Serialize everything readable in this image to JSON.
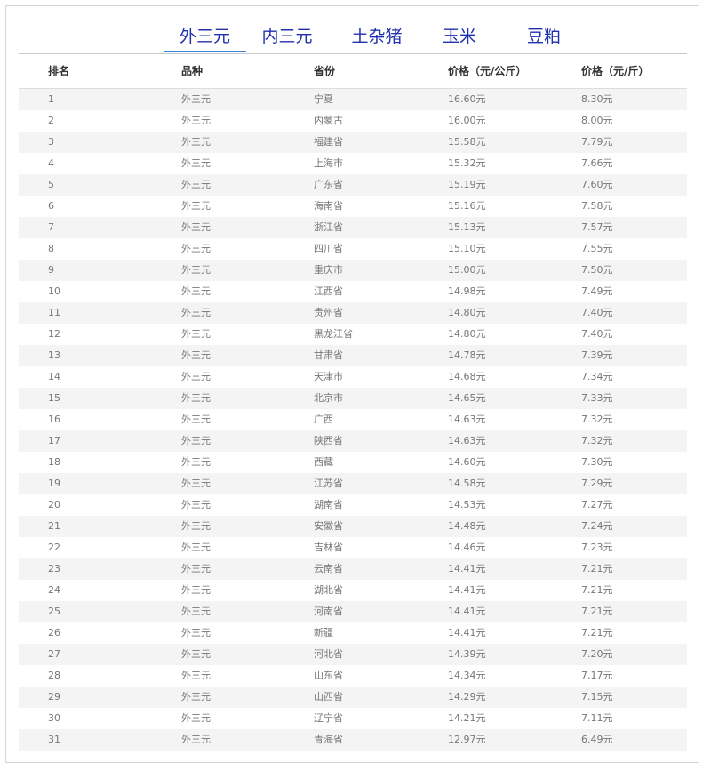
{
  "tabs": [
    {
      "label": "外三元",
      "active": true
    },
    {
      "label": "内三元",
      "active": false
    },
    {
      "label": "土杂猪",
      "active": false
    },
    {
      "label": "玉米",
      "active": false
    },
    {
      "label": "豆粕",
      "active": false
    }
  ],
  "table": {
    "headers": [
      "排名",
      "品种",
      "省份",
      "价格（元/公斤）",
      "价格（元/斤）"
    ],
    "rows": [
      [
        "1",
        "外三元",
        "宁夏",
        "16.60元",
        "8.30元"
      ],
      [
        "2",
        "外三元",
        "内蒙古",
        "16.00元",
        "8.00元"
      ],
      [
        "3",
        "外三元",
        "福建省",
        "15.58元",
        "7.79元"
      ],
      [
        "4",
        "外三元",
        "上海市",
        "15.32元",
        "7.66元"
      ],
      [
        "5",
        "外三元",
        "广东省",
        "15.19元",
        "7.60元"
      ],
      [
        "6",
        "外三元",
        "海南省",
        "15.16元",
        "7.58元"
      ],
      [
        "7",
        "外三元",
        "浙江省",
        "15.13元",
        "7.57元"
      ],
      [
        "8",
        "外三元",
        "四川省",
        "15.10元",
        "7.55元"
      ],
      [
        "9",
        "外三元",
        "重庆市",
        "15.00元",
        "7.50元"
      ],
      [
        "10",
        "外三元",
        "江西省",
        "14.98元",
        "7.49元"
      ],
      [
        "11",
        "外三元",
        "贵州省",
        "14.80元",
        "7.40元"
      ],
      [
        "12",
        "外三元",
        "黑龙江省",
        "14.80元",
        "7.40元"
      ],
      [
        "13",
        "外三元",
        "甘肃省",
        "14.78元",
        "7.39元"
      ],
      [
        "14",
        "外三元",
        "天津市",
        "14.68元",
        "7.34元"
      ],
      [
        "15",
        "外三元",
        "北京市",
        "14.65元",
        "7.33元"
      ],
      [
        "16",
        "外三元",
        "广西",
        "14.63元",
        "7.32元"
      ],
      [
        "17",
        "外三元",
        "陕西省",
        "14.63元",
        "7.32元"
      ],
      [
        "18",
        "外三元",
        "西藏",
        "14.60元",
        "7.30元"
      ],
      [
        "19",
        "外三元",
        "江苏省",
        "14.58元",
        "7.29元"
      ],
      [
        "20",
        "外三元",
        "湖南省",
        "14.53元",
        "7.27元"
      ],
      [
        "21",
        "外三元",
        "安徽省",
        "14.48元",
        "7.24元"
      ],
      [
        "22",
        "外三元",
        "吉林省",
        "14.46元",
        "7.23元"
      ],
      [
        "23",
        "外三元",
        "云南省",
        "14.41元",
        "7.21元"
      ],
      [
        "24",
        "外三元",
        "湖北省",
        "14.41元",
        "7.21元"
      ],
      [
        "25",
        "外三元",
        "河南省",
        "14.41元",
        "7.21元"
      ],
      [
        "26",
        "外三元",
        "新疆",
        "14.41元",
        "7.21元"
      ],
      [
        "27",
        "外三元",
        "河北省",
        "14.39元",
        "7.20元"
      ],
      [
        "28",
        "外三元",
        "山东省",
        "14.34元",
        "7.17元"
      ],
      [
        "29",
        "外三元",
        "山西省",
        "14.29元",
        "7.15元"
      ],
      [
        "30",
        "外三元",
        "辽宁省",
        "14.21元",
        "7.11元"
      ],
      [
        "31",
        "外三元",
        "青海省",
        "12.97元",
        "6.49元"
      ]
    ]
  }
}
